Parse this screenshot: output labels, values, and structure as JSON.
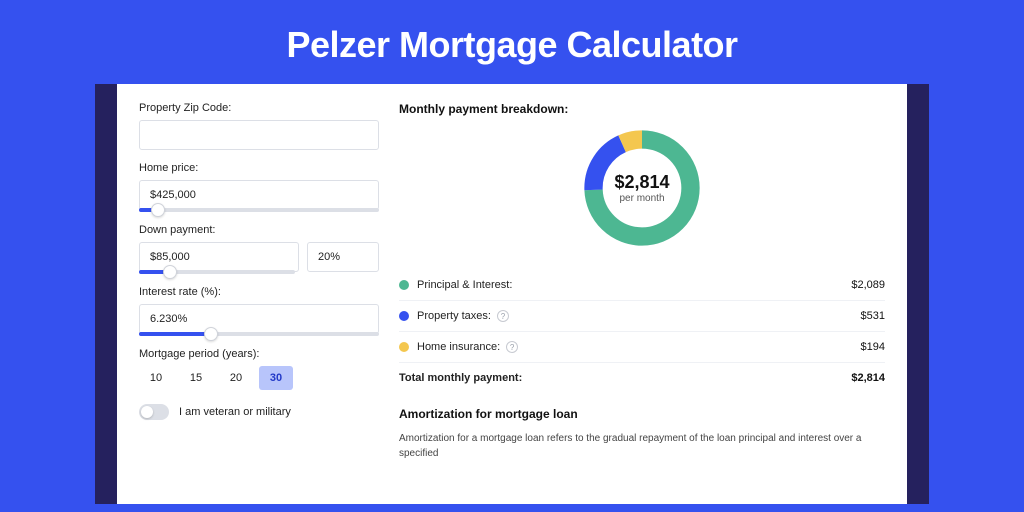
{
  "page": {
    "title": "Pelzer Mortgage Calculator"
  },
  "form": {
    "zip": {
      "label": "Property Zip Code:",
      "value": ""
    },
    "home_price": {
      "label": "Home price:",
      "value": "$425,000",
      "slider_pct": 8
    },
    "down_payment": {
      "label": "Down payment:",
      "amount": "$85,000",
      "percent": "20%",
      "slider_pct": 20
    },
    "interest_rate": {
      "label": "Interest rate (%):",
      "value": "6.230%",
      "slider_pct": 30
    },
    "mortgage_period": {
      "label": "Mortgage period (years):",
      "options": [
        "10",
        "15",
        "20",
        "30"
      ],
      "selected": "30"
    },
    "veteran": {
      "label": "I am veteran or military",
      "checked": false
    }
  },
  "breakdown": {
    "heading": "Monthly payment breakdown:",
    "total": "$2,814",
    "per": "per month",
    "items": [
      {
        "label": "Principal & Interest:",
        "value": "$2,089",
        "color": "#4db792",
        "info": false
      },
      {
        "label": "Property taxes:",
        "value": "$531",
        "color": "#3551ef",
        "info": true
      },
      {
        "label": "Home insurance:",
        "value": "$194",
        "color": "#f4c74f",
        "info": true
      }
    ],
    "total_row": {
      "label": "Total monthly payment:",
      "value": "$2,814"
    }
  },
  "amort": {
    "heading": "Amortization for mortgage loan",
    "body": "Amortization for a mortgage loan refers to the gradual repayment of the loan principal and interest over a specified"
  },
  "chart_data": {
    "type": "pie",
    "title": "Monthly payment breakdown",
    "series": [
      {
        "name": "Principal & Interest",
        "value": 2089,
        "color": "#4db792"
      },
      {
        "name": "Property taxes",
        "value": 531,
        "color": "#3551ef"
      },
      {
        "name": "Home insurance",
        "value": 194,
        "color": "#f4c74f"
      }
    ],
    "total": 2814,
    "center_label": "$2,814",
    "center_sub": "per month"
  }
}
